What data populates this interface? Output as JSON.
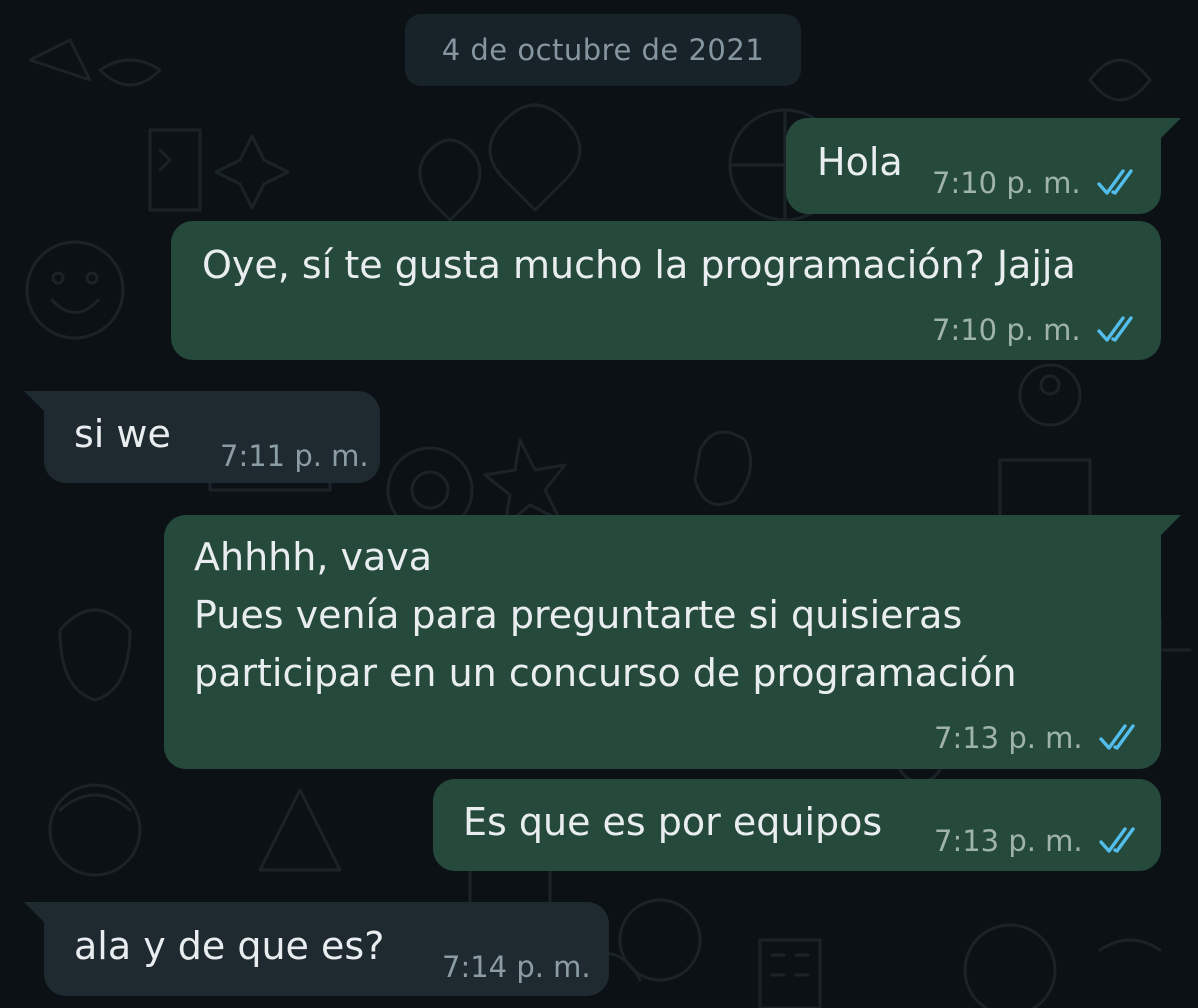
{
  "date_chip": "4 de octubre de 2021",
  "messages": [
    {
      "direction": "outgoing",
      "lines": [
        "Hola"
      ],
      "time": "7:10 p. m.",
      "status_icon": "double-check-read-icon"
    },
    {
      "direction": "outgoing",
      "lines": [
        "Oye, sí te gusta mucho la programación? Jajja"
      ],
      "time": "7:10 p. m.",
      "status_icon": "double-check-read-icon"
    },
    {
      "direction": "incoming",
      "lines": [
        "si we"
      ],
      "time": "7:11 p. m."
    },
    {
      "direction": "outgoing",
      "lines": [
        "Ahhhh, vava",
        "Pues venía para preguntarte si quisieras",
        "participar en un concurso de programación"
      ],
      "time": "7:13 p. m.",
      "status_icon": "double-check-read-icon"
    },
    {
      "direction": "outgoing",
      "lines": [
        "Es que es por equipos"
      ],
      "time": "7:13 p. m.",
      "status_icon": "double-check-read-icon"
    },
    {
      "direction": "incoming",
      "lines": [
        "ala y de que es?"
      ],
      "time": "7:14 p. m."
    }
  ],
  "colors": {
    "background": "#0c1115",
    "outgoing_bubble": "#254a3c",
    "incoming_bubble": "#1f2a30",
    "read_ticks": "#53bdeb",
    "message_text": "#e9edef"
  }
}
